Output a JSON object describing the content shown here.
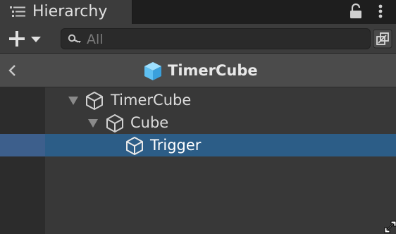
{
  "tab": {
    "title": "Hierarchy",
    "icon": "hierarchy-list-icon"
  },
  "toolbar": {
    "add_icon": "plus-dropdown-icon",
    "search": {
      "placeholder": "All",
      "icon": "search-icon"
    },
    "expand_icon": "open-in-scene-icon"
  },
  "header": {
    "title": "TimerCube",
    "icon": "prefab-cube-icon",
    "back_icon": "chevron-left-icon"
  },
  "tree": {
    "items": [
      {
        "label": "TimerCube",
        "icon": "cube-icon",
        "expanded": true,
        "depth": 0,
        "selected": false
      },
      {
        "label": "Cube",
        "icon": "cube-icon",
        "expanded": true,
        "depth": 1,
        "selected": false
      },
      {
        "label": "Trigger",
        "icon": "cube-icon",
        "expanded": false,
        "depth": 2,
        "selected": true
      }
    ]
  },
  "colors": {
    "selection": "#2c5d87",
    "prefab_accent": "#5fc0f2",
    "background": "#383838"
  }
}
